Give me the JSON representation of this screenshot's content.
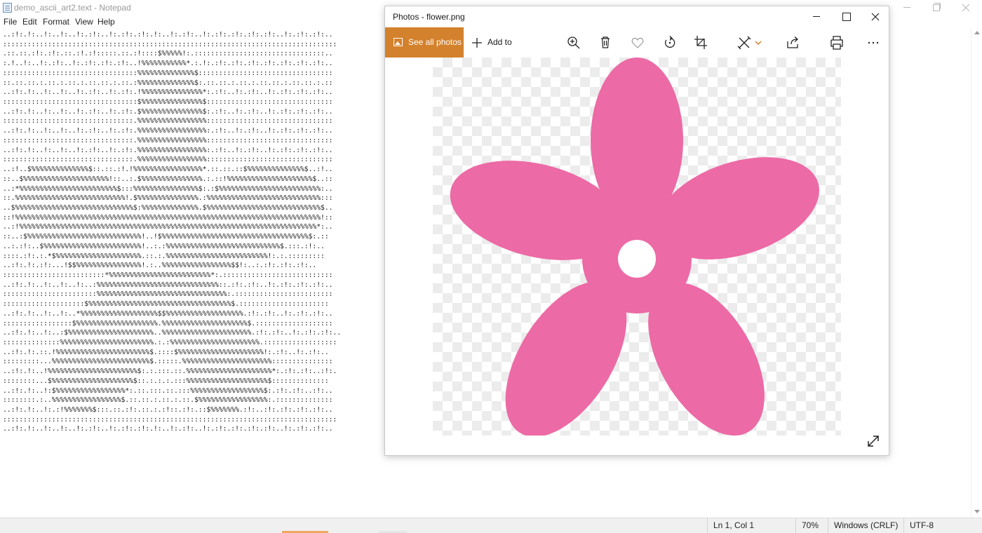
{
  "notepad": {
    "title": "demo_ascii_art2.text - Notepad",
    "menu": [
      "File",
      "Edit",
      "Format",
      "View",
      "Help"
    ],
    "lines": [
      "..:!:.!:..!:..!:..!:.:!:..!:.:!:.:!:.!:..!:.:!:..!:.:!:.:!:.:!:.:!:..!:.:!:.:!:..",
      "::::::::::::::::::::::::::::::::::::::::::::::::::::::::::::::::::::::::::::::::::",
      ".::.::.:!:.:!:.::.:!.:!:::::.::.:!::::$%%%%%!:.::::::::::::::::::::::::::::::::..",
      ":.!..!:..!:.:!:..!:.:!:.:!:.:!:..!%%%%%%%%%%%*.:.!:.:!:.:!:.:!:.:!:.:!:.:!:.:!:..",
      ":::::::::::::::::::::::::::::::::%%%%%%%%%%%%%%$:::::::::::::::::::::::::::::::::",
      "::.::.::.:.::.:.::.:.::.::.:.::.:%%%%%%%%%%%%%%$:.::.::.:.::.:.::.::.:.::.::.:.::",
      "..:!:.!:..!:..!:..!:.:!:..!:.:!:.!%%%%%%%%%%%%%%%*:.:!:..!:.:!:..!:.:!:.:!:.:!:..",
      ":::::::::::::::::::::::::::::::::$%%%%%%%%%%%%%%%$:::::::::::::::::::::::::::::::",
      "..:!:.!:..!:..!:..!:.:!:..!:.:!:.$%%%%%%%%%%%%%%%$:.:!:..!:.:!:..!:.:!:.:!:.:!:..",
      "::::::::::::::::::::::::::::::::.%%%%%%%%%%%%%%%%%:::::::::::::::::::::::::::::::",
      "..:!:.!:..!:..!:..!:.:!:..!:.:!:.%%%%%%%%%%%%%%%%%:.:!:..!:.:!:..!:.:!:.:!:.:!:..",
      "::::::::::::::::::::::::::::::::.%%%%%%%%%%%%%%%%%:::::::::::::::::::::::::::::::",
      "..:!:.!:..!:..!:..!:.:!:..!:.:!:.%%%%%%%%%%%%%%%%%:.:!:..!:.:!:..!:.:!:.:!:.:!:..",
      "::::::::::::::::::::::::::::::::.%%%%%%%%%%%%%%%%%:::::::::::::::::::::::::::::::",
      "..:!..$%%%%%%%%%%%%%%$::.::.:!.!%%%%%%%%%%%%%%%%%*.::.::.::$%%%%%%%%%%%%%%$..:!..",
      "::..$%%%%%%%%%%%%%%%%%%%%%!::..:.$%%%%%%%%%%%%%%%.:.::!%%%%%%%%%%%%%%%%%%%%%$..::",
      "..:*%%%%%%%%%%%%%%%%%%%%%%%%$:::%%%%%%%%%%%%%%%%$:.:$%%%%%%%%%%%%%%%%%%%%%%%%%:..",
      "::.%%%%%%%%%%%%%%%%%%%%%%%%%%%!.$%%%%%%%%%%%%%%%.:%%%%%%%%%%%%%%%%%%%%%%%%%%%%:::",
      "..$%%%%%%%%%%%%%%%%%%%%%%%%%%%%%$:%%%%%%%%%%%%%%.$%%%%%%%%%%%%%%%%%%%%%%%%%%%%$..",
      "::!%%%%%%%%%%%%%%%%%%%%%%%%%%%%%%%%%%%%%%%%%%%%%%%%%%%%%%%%%%%%%%%%%%%%%%%%%%%!::",
      "..:!%%%%%%%%%%%%%%%%%%%%%%%%%%%%%%%%%%%%%%%%%%%%%%%%%%%%%%%%%%%%%%%%%%%%%%%%%*:..",
      "::..:$%%%%%%%%%%%%%%%%%%%%%%%%%%%%!..!$%%%%%%%%%%%%%%%%%%%%%%%%%%%%%%%%%%%%$:.::",
      "..:.:!:..$%%%%%%%%%%%%%%%%%%%%%%%%!..:.:%%%%%%%%%%%%%%%%%%%%%%%%%%%%$.:::.:!:..",
      "::::.:!:.:.*$%%%%%%%%%%%%%%%%%%%%%.::.:.%%%%%%%%%%%%%%%%%%%%%%%%%!:.:.:::::::::",
      "..:!:.!:.:!:...!$$%%%%%%%%%%%%%%%%!.:..%%%%%%%%%%%%%%%%%$$!:..:.:!:.:!:.:!:..",
      ":::::::::::::::::::::::::*%%%%%%%%%%%%%%%%%%%%%%%%%*:.:::::::::::::::::::::::::::",
      "..:!:.!:..!:..!:..!:..:%%%%%%%%%%%%%%%%%%%%%%%%%%%%%%::.:!:.:!:..!:.:!:.:!:.:!:..",
      ":::::::::::::::::::::::%%%%%%%%%%%%%%%%%%%%%%%%%%%%%%%%:.::::::::::::::::::::::::",
      "::::::::::::::::::::$%%%%%%%%%%%%%%%%%%%%%%%%%%%%%%%%%%%$.::::::::::::::::::::::",
      "..:!:.!:..!:..!:..*%%%%%%%%%%%%%%%%%%%$$%%%%%%%%%%%%%%%%%%%.:!:.:!:..!:.:!:.:!:..",
      ":::::::::::::::::$%%%%%%%%%%%%%%%%%%%%.%%%%%%%%%%%%%%%%%%%%%$.:::::::::::::::::::",
      "..:!:.!:..!:..:$%%%%%%%%%%%%%%%%%%%%%..%%%%%%%%%%%%%%%%%%%%%%.:!:.:!:..!:.:!:.:!:..",
      "::::::::::::::%%%%%%%%%%%%%%%%%%%%%%%.:.:%%%%%%%%%%%%%%%%%%%%%%.::::::::::::::::::",
      "..:!:.!:.::.!%%%%%%%%%%%%%%%%%%%%%%%$.::::$%%%%%%%%%%%%%%%%%%%%%!:.:!:..!:.:!:..",
      ":::::::::...%%%%%%%%%%%%%%%%%%%%%%%%$.:::::.%%%%%%%%%%%%%%%%%%%%%%:::::::::::::::",
      "..:!:.!:..!%%%%%%%%%%%%%%%%%%%%%%$:.:.:::.::.%%%%%%%%%%%%%%%%%%%%%*:.:!:.:!:..:!:.",
      "::::::::...$%%%%%%%%%%%%%%%%%%%%$::.:.:.:.:::%%%%%%%%%%%%%%%%%%%%$::::::::::::::",
      "..:!:.!:..!:$%%%%%%%%%%%%%%%%%*:.::.:::.::.:::%%%%%%%%%%%%%%%%%%$:.:!:.:!:..:!:..",
      "::::::::.:..%%%%%%%%%%%%%%%%%$.::.::.:.::.:.::.$%%%%%%%%%%%%%%%%%:.::::::::::::::",
      "..:!:.!:..!:.:!%%%%%%%$:::.::.:!:.::.:.:!::.:!:.::$%%%%%%%.:!:..:!:.:!:.:!:.:!:..",
      "::::::::::::::::::::::::::::::::::::::::::::::::::::::::::::::::::::::::::::::::::",
      "..:!:.!:..!:..!:..!:.:!:..!:.:!:.:!:.!:..!:.:!:..!:.:!:.:!:.:!:.:!:..!:.:!:.:!:.."
    ],
    "status": {
      "position": "Ln 1, Col 1",
      "zoom": "70%",
      "line_ending": "Windows (CRLF)",
      "encoding": "UTF-8"
    }
  },
  "photos": {
    "title": "Photos - flower.png",
    "see_all_label": "See all photos",
    "add_to_label": "Add to",
    "accent_color": "#d3812c",
    "flower_color": "#ec6aa6",
    "tools": [
      "zoom-in-icon",
      "delete-icon",
      "favorite-icon",
      "rotate-icon",
      "crop-icon",
      "edit-icon",
      "share-icon",
      "print-icon",
      "more-icon"
    ]
  }
}
